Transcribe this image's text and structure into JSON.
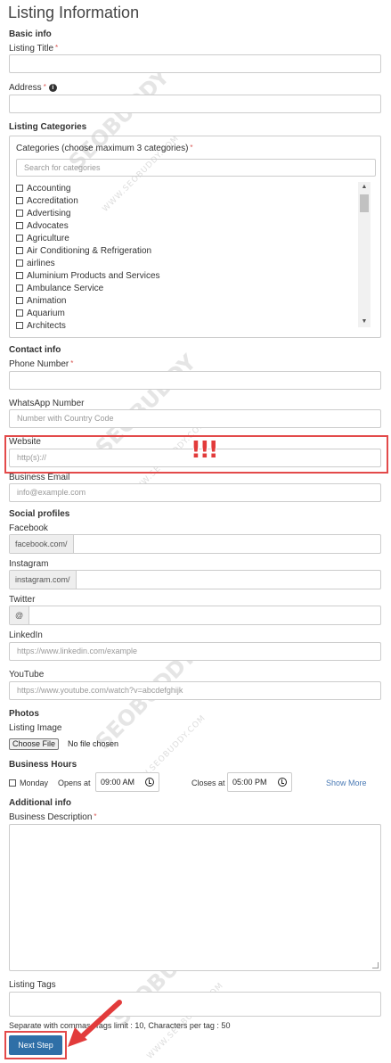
{
  "page_title": "Listing Information",
  "basic_info": {
    "section": "Basic info",
    "listing_title_label": "Listing Title",
    "required_mark": "*",
    "address_label": "Address",
    "info_mark": "i"
  },
  "categories": {
    "section": "Listing Categories",
    "box_title": "Categories (choose maximum 3 categories)",
    "search_placeholder": "Search for categories",
    "items": [
      "Accounting",
      "Accreditation",
      "Advertising",
      "Advocates",
      "Agriculture",
      "Air Conditioning & Refrigeration",
      "airlines",
      "Aluminium Products and Services",
      "Ambulance Service",
      "Animation",
      "Aquarium",
      "Architects"
    ],
    "scroll_up": "▲",
    "scroll_down": "▼"
  },
  "contact": {
    "section": "Contact info",
    "phone_label": "Phone Number",
    "whatsapp_label": "WhatsApp Number",
    "whatsapp_placeholder": "Number with Country Code",
    "website_label": "Website",
    "website_placeholder": "http(s)://",
    "email_label": "Business Email",
    "email_placeholder": "info@example.com"
  },
  "social": {
    "section": "Social profiles",
    "facebook_label": "Facebook",
    "facebook_prefix": "facebook.com/",
    "instagram_label": "Instagram",
    "instagram_prefix": "instagram.com/",
    "twitter_label": "Twitter",
    "twitter_prefix": "@",
    "linkedin_label": "LinkedIn",
    "linkedin_placeholder": "https://www.linkedin.com/example",
    "youtube_label": "YouTube",
    "youtube_placeholder": "https://www.youtube.com/watch?v=abcdefghijk"
  },
  "photos": {
    "section": "Photos",
    "listing_image_label": "Listing Image",
    "choose_file": "Choose File",
    "no_file": "No file chosen"
  },
  "hours": {
    "section": "Business Hours",
    "day": "Monday",
    "opens_label": "Opens at",
    "opens_value": "09:00 AM",
    "closes_label": "Closes at",
    "closes_value": "05:00 PM",
    "show_more": "Show More"
  },
  "additional": {
    "section": "Additional info",
    "description_label": "Business Description",
    "tags_label": "Listing Tags",
    "tags_help": "Separate with commas. Tags limit : 10, Characters per tag : 50"
  },
  "next_button": "Next Step",
  "annotation_text": "!!!",
  "watermark": "SEOBUDDY",
  "watermark_sub": "WWW.SEOBUDDY.COM",
  "colors": {
    "primary_button": "#2f6fa7",
    "highlight": "#e34a4a",
    "required": "#d9534f",
    "link": "#4a7ab5"
  }
}
